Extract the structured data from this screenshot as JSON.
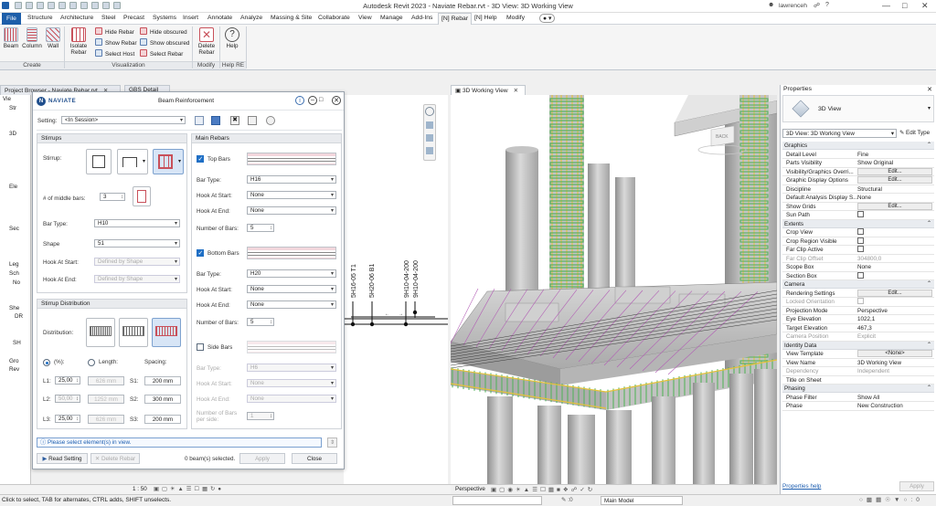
{
  "app": {
    "title": "Autodesk Revit 2023 - Naviate Rebar.rvt - 3D View: 3D Working View",
    "user": "lawrenceh"
  },
  "ribbon_tabs": [
    "File",
    "Structure",
    "Architecture",
    "Steel",
    "Precast",
    "Systems",
    "Insert",
    "Annotate",
    "Analyze",
    "Massing & Site",
    "Collaborate",
    "View",
    "Manage",
    "Add-Ins",
    "[N] Rebar",
    "[N] Help",
    "Modify"
  ],
  "ribbon": {
    "create": {
      "label": "Create",
      "beam": "Beam",
      "column": "Column",
      "wall": "Wall"
    },
    "visualization": {
      "label": "Visualization",
      "isolate_rebar": "Isolate\nRebar",
      "hide_rebar": "Hide Rebar",
      "show_rebar": "Show Rebar",
      "select_host": "Select Host",
      "hide_obscured": "Hide obscured",
      "show_obscured": "Show obscured",
      "select_rebar": "Select Rebar"
    },
    "modify": {
      "label": "Modify",
      "delete_rebar": "Delete\nRebar"
    },
    "help": {
      "label": "Help RE",
      "help": "Help"
    }
  },
  "view_tabs": {
    "project_browser": "Project Browser - Naviate Rebar.rvt",
    "gbs_detail": "GBS Detail",
    "working_3d": "3D Working View",
    "properties": "Properties"
  },
  "project_browser": {
    "items": [
      "Vie",
      "Str",
      "3D",
      "Ele",
      "Sec",
      "Leg",
      "Sch",
      "No",
      "She",
      "DR",
      "SH",
      "Gro",
      "Rev"
    ]
  },
  "dialog": {
    "brand": "NAVIATE",
    "title": "Beam Reinforcement",
    "setting_label": "Setting:",
    "setting_value": "<In Session>",
    "stirrups": {
      "header": "Stirrups",
      "stirrup_label": "Stirrup:",
      "middle_bars_label": "# of middle bars:",
      "middle_bars_value": "3",
      "bar_type_label": "Bar Type:",
      "bar_type_value": "H10",
      "shape_label": "Shape",
      "shape_value": "51",
      "hook_start_label": "Hook At Start:",
      "hook_start_value": "Defined by Shape",
      "hook_end_label": "Hook At End:",
      "hook_end_value": "Defined by Shape"
    },
    "distribution": {
      "header": "Stirrup Distribution",
      "distribution_label": "Distribution:",
      "pct_label": "(%):",
      "length_label": "Length:",
      "spacing_label": "Spacing:",
      "rows": [
        {
          "l": "L1:",
          "pct": "25,00",
          "len": "626 mm",
          "s": "S1:",
          "spacing": "200 mm",
          "pct_dim": false
        },
        {
          "l": "L2:",
          "pct": "50,00",
          "len": "1252 mm",
          "s": "S2:",
          "spacing": "300 mm",
          "pct_dim": true
        },
        {
          "l": "L3:",
          "pct": "25,00",
          "len": "626 mm",
          "s": "S3:",
          "spacing": "200 mm",
          "pct_dim": false
        }
      ]
    },
    "main_rebars": {
      "header": "Main Rebars",
      "top": {
        "label": "Top Bars",
        "bar_type": "H16",
        "hook_start": "None",
        "hook_end": "None",
        "count": "5"
      },
      "bottom": {
        "label": "Bottom Bars",
        "bar_type": "H20",
        "hook_start": "None",
        "hook_end": "None",
        "count": "5"
      },
      "side": {
        "label": "Side Bars",
        "bar_type": "H6",
        "hook_start": "None",
        "hook_end": "None",
        "count": "1"
      },
      "bar_type_label": "Bar Type:",
      "hook_start_label": "Hook At Start:",
      "hook_end_label": "Hook At End:",
      "number_label": "Number of Bars:",
      "number_side_label": "Number of Bars per side:"
    },
    "info": "Please select element(s) in view.",
    "read_setting": "Read Setting",
    "delete_rebar": "Delete Rebar",
    "selected": "0 beam(s) selected.",
    "apply": "Apply",
    "close": "Close"
  },
  "drawing_labels": [
    "5H16-05 T1",
    "5H20-06 B1",
    "9H10-04-200",
    "9H10-04-200"
  ],
  "viewcube": {
    "back": "BACK"
  },
  "properties": {
    "type_name": "3D View",
    "selector": "3D View: 3D Working View",
    "edit_type": "Edit Type",
    "sections": [
      {
        "cat": "Graphics",
        "rows": [
          {
            "k": "Detail Level",
            "v": "Fine",
            "kind": "text"
          },
          {
            "k": "Parts Visibility",
            "v": "Show Original",
            "kind": "text"
          },
          {
            "k": "Visibility/Graphics Overri...",
            "v": "Edit...",
            "kind": "btn"
          },
          {
            "k": "Graphic Display Options",
            "v": "Edit...",
            "kind": "btn"
          },
          {
            "k": "Discipline",
            "v": "Structural",
            "kind": "text"
          },
          {
            "k": "Default Analysis Display S...",
            "v": "None",
            "kind": "text"
          },
          {
            "k": "Show Grids",
            "v": "Edit...",
            "kind": "btn"
          },
          {
            "k": "Sun Path",
            "v": "",
            "kind": "chk"
          }
        ]
      },
      {
        "cat": "Extents",
        "rows": [
          {
            "k": "Crop View",
            "v": "",
            "kind": "chk"
          },
          {
            "k": "Crop Region Visible",
            "v": "",
            "kind": "chk"
          },
          {
            "k": "Far Clip Active",
            "v": "",
            "kind": "chk"
          },
          {
            "k": "Far Clip Offset",
            "v": "304800,0",
            "kind": "dim"
          },
          {
            "k": "Scope Box",
            "v": "None",
            "kind": "text"
          },
          {
            "k": "Section Box",
            "v": "",
            "kind": "chk"
          }
        ]
      },
      {
        "cat": "Camera",
        "rows": [
          {
            "k": "Rendering Settings",
            "v": "Edit...",
            "kind": "btn"
          },
          {
            "k": "Locked Orientation",
            "v": "",
            "kind": "dimchk"
          },
          {
            "k": "Projection Mode",
            "v": "Perspective",
            "kind": "text"
          },
          {
            "k": "Eye Elevation",
            "v": "1022,1",
            "kind": "text"
          },
          {
            "k": "Target Elevation",
            "v": "467,3",
            "kind": "text"
          },
          {
            "k": "Camera Position",
            "v": "Explicit",
            "kind": "dim"
          }
        ]
      },
      {
        "cat": "Identity Data",
        "rows": [
          {
            "k": "View Template",
            "v": "<None>",
            "kind": "btn"
          },
          {
            "k": "View Name",
            "v": "3D Working View",
            "kind": "text"
          },
          {
            "k": "Dependency",
            "v": "Independent",
            "kind": "dim"
          },
          {
            "k": "Title on Sheet",
            "v": "",
            "kind": "text"
          }
        ]
      },
      {
        "cat": "Phasing",
        "rows": [
          {
            "k": "Phase Filter",
            "v": "Show All",
            "kind": "text"
          },
          {
            "k": "Phase",
            "v": "New Construction",
            "kind": "text"
          }
        ]
      }
    ],
    "help_link": "Properties help",
    "apply": "Apply"
  },
  "status": {
    "message": "Click to select, TAB for alternates, CTRL adds, SHIFT unselects.",
    "scale": "1 : 50",
    "view_mode": "Perspective",
    "model": "Main Model",
    "selection_count": ":0"
  },
  "colors": {
    "accent": "#1f6fc5",
    "file_tab": "#1d5ea9",
    "concrete": "#c9c9c9",
    "rebar_yellow": "#e5c23a",
    "rebar_green": "#57b25d",
    "rebar_purple": "#b25fb5"
  }
}
